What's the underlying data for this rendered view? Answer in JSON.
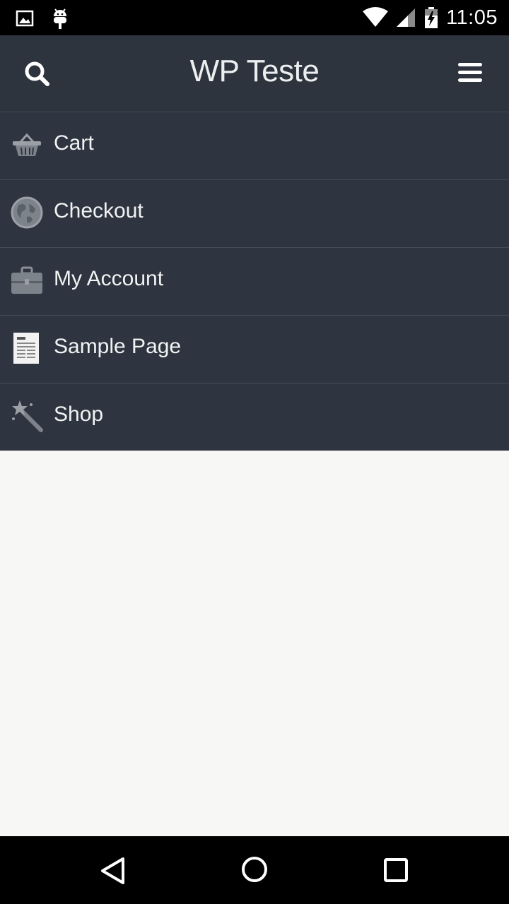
{
  "status_bar": {
    "time": "11:05",
    "icons": [
      "image-notification-icon",
      "android-debug-icon",
      "wifi-icon",
      "cell-signal-icon",
      "battery-charging-icon"
    ]
  },
  "header": {
    "title": "WP Teste",
    "search_icon": "search-icon",
    "menu_icon": "hamburger-menu-icon",
    "background": "#2e343e"
  },
  "menu": {
    "background": "#2f3540",
    "items": [
      {
        "label": "Cart",
        "icon": "basket-icon"
      },
      {
        "label": "Checkout",
        "icon": "globe-icon"
      },
      {
        "label": "My Account",
        "icon": "briefcase-icon"
      },
      {
        "label": "Sample Page",
        "icon": "document-icon"
      },
      {
        "label": "Shop",
        "icon": "magic-wand-icon"
      }
    ]
  },
  "content": {
    "background": "#f7f7f5"
  },
  "navigation_bar": {
    "buttons": [
      "back-icon",
      "home-icon",
      "recents-icon"
    ]
  }
}
